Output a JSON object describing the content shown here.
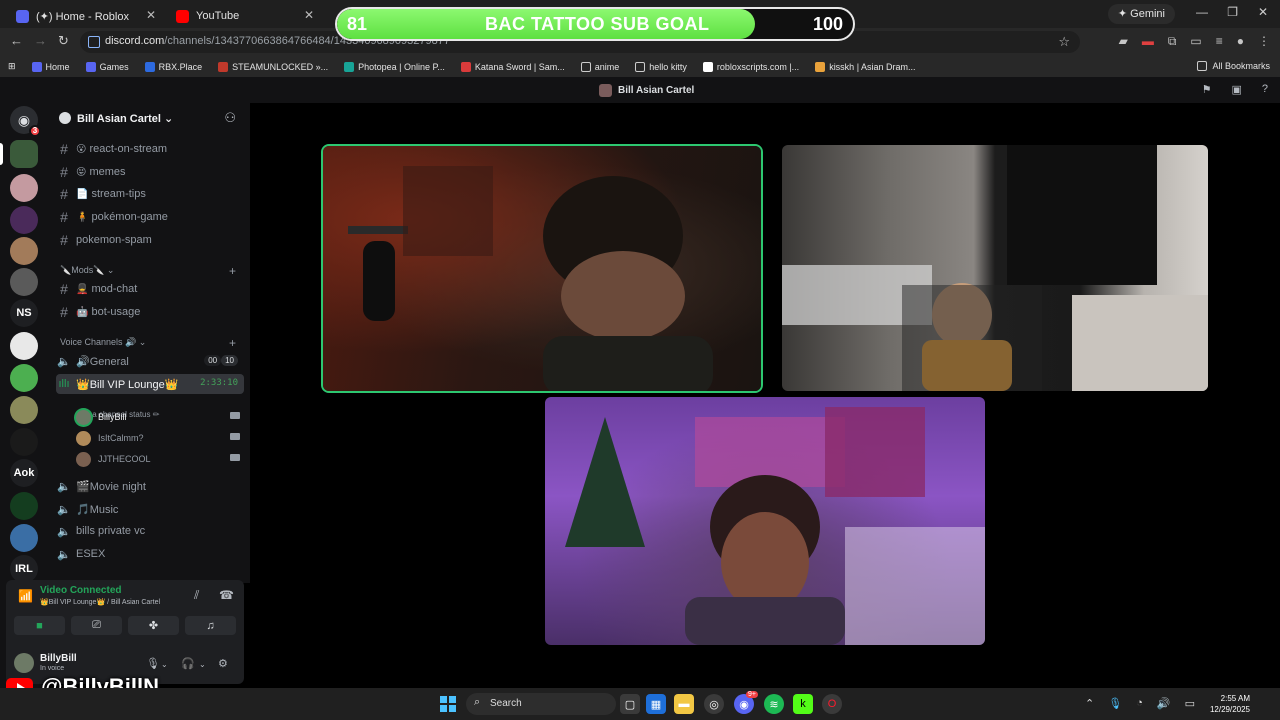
{
  "browser": {
    "tabs": [
      {
        "title": "(✦) Home - Roblox"
      },
      {
        "title": "YouTube"
      }
    ],
    "gemini_label": "Gemini",
    "url_host": "discord.com",
    "url_path": "/channels/1343770663864766484/1433409689093279877",
    "bookmarks": [
      "Home",
      "Games",
      "RBX.Place",
      "STEAMUNLOCKED »...",
      "Photopea | Online P...",
      "Katana Sword | Sam...",
      "anime",
      "hello kitty",
      "robloxscripts.com |...",
      "kisskh | Asian Dram..."
    ],
    "all_bookmarks": "All Bookmarks"
  },
  "sub_goal": {
    "title": "BAC TATTOO SUB GOAL",
    "current": "81",
    "target": "100",
    "progress": 0.81,
    "fill_color": "#5ee041"
  },
  "discord": {
    "window_title": "Bill Asian Cartel",
    "dm_badge": "3",
    "server": {
      "name": "Bill Asian Cartel"
    },
    "guild_labels": {
      "ns": "NS",
      "aok": "Aok",
      "irl": "IRL"
    },
    "channels": [
      {
        "emoji": "😮",
        "name": "react-on-stream"
      },
      {
        "emoji": "😝",
        "name": "memes"
      },
      {
        "emoji": "📄",
        "name": "stream-tips"
      },
      {
        "emoji": "🧍",
        "name": "pokémon-game"
      },
      {
        "emoji": "",
        "name": "pokemon-spam"
      }
    ],
    "mods_category": "🔪Mods🔪",
    "mod_channels": [
      {
        "emoji": "💂",
        "name": "mod-chat"
      },
      {
        "emoji": "🤖",
        "name": "bot-usage"
      }
    ],
    "voice_category": "Voice Channels 🔊",
    "voice_channels": {
      "general": {
        "name": "🔊General",
        "count_a": "00",
        "count_b": "10"
      },
      "vip": {
        "name": "👑Bill VIP Lounge👑",
        "timer": "2:33:10",
        "status_hint": "Set a channel status ✏"
      },
      "movie": {
        "name": "🎬Movie night"
      },
      "music": {
        "name": "🎵Music"
      },
      "private": {
        "name": "bills private vc"
      },
      "esex": {
        "name": "ESEX"
      }
    },
    "members": [
      {
        "name": "BillyBill"
      },
      {
        "name": "IsItCalmm?"
      },
      {
        "name": "JJTHECOOL"
      }
    ],
    "voice_panel": {
      "status": "Video Connected",
      "location": "👑Bill VIP Lounge👑 / Bill Asian Cartel"
    },
    "user": {
      "name": "BillyBill",
      "status": "In voice"
    }
  },
  "overlay": {
    "youtube_handle": "@BillyBillN"
  },
  "taskbar": {
    "search_label": "Search",
    "time": "2:55 AM",
    "date": "12/29/2025",
    "discord_badge": "9+"
  }
}
